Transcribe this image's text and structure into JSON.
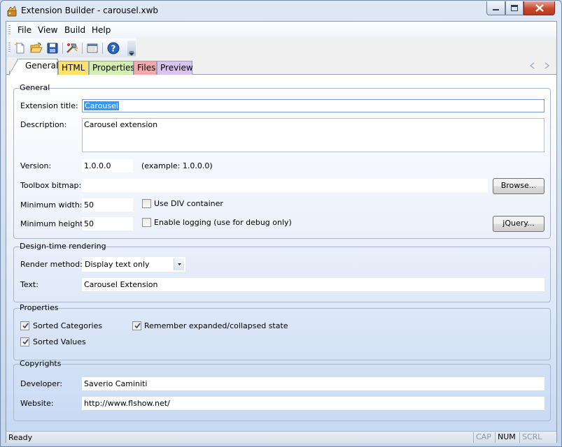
{
  "window": {
    "title": "Extension Builder - carousel.xwb"
  },
  "menu": {
    "file": "File",
    "view": "View",
    "build": "Build",
    "help": "Help"
  },
  "toolbar": {
    "icons": [
      "new-file-icon",
      "open-folder-icon",
      "save-icon",
      "build-icon",
      "settings-icon",
      "help-icon"
    ]
  },
  "tabs": [
    {
      "label": "General",
      "color": "#ffffff"
    },
    {
      "label": "HTML",
      "color": "#ffe16b"
    },
    {
      "label": "Properties",
      "color": "#d5eeb0"
    },
    {
      "label": "Files",
      "color": "#f6a9ab"
    },
    {
      "label": "Preview",
      "color": "#d9c4ef"
    }
  ],
  "general": {
    "group_title": "General",
    "extension_title_label": "Extension title:",
    "extension_title_value": "Carousel",
    "description_label": "Description:",
    "description_value": "Carousel extension",
    "version_label": "Version:",
    "version_value": "1.0.0.0",
    "version_hint": "(example: 1.0.0.0)",
    "toolbox_bitmap_label": "Toolbox bitmap:",
    "toolbox_bitmap_value": "",
    "browse_button": "Browse...",
    "min_width_label": "Minimum width:",
    "min_width_value": "50",
    "min_height_label": "Minimum height:",
    "min_height_value": "50",
    "use_div_label": "Use DIV container",
    "use_div_checked": false,
    "enable_logging_label": "Enable logging (use for debug only)",
    "enable_logging_checked": false,
    "jquery_button": "jQuery..."
  },
  "design_time": {
    "group_title": "Design-time rendering",
    "render_method_label": "Render method:",
    "render_method_value": "Display text only",
    "text_label": "Text:",
    "text_value": "Carousel Extension"
  },
  "properties": {
    "group_title": "Properties",
    "sorted_categories_label": "Sorted Categories",
    "sorted_categories_checked": true,
    "remember_state_label": "Remember expanded/collapsed state",
    "remember_state_checked": true,
    "sorted_values_label": "Sorted Values",
    "sorted_values_checked": true
  },
  "copyrights": {
    "group_title": "Copyrights",
    "developer_label": "Developer:",
    "developer_value": "Saverio Caminiti",
    "website_label": "Website:",
    "website_value": "http://www.flshow.net/"
  },
  "status": {
    "text": "Ready",
    "cap": "CAP",
    "num": "NUM",
    "scrl": "SCRL"
  }
}
